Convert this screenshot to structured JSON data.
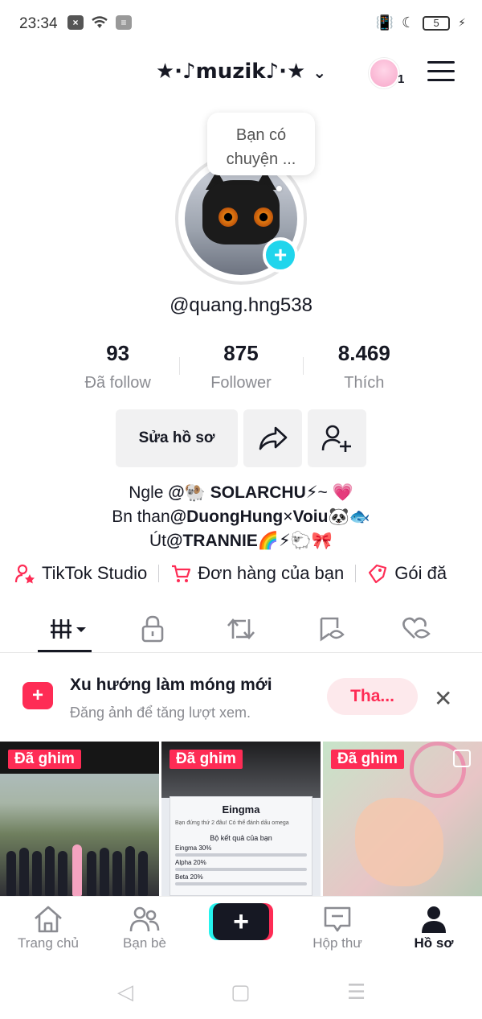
{
  "status_bar": {
    "time": "23:34",
    "battery": "5"
  },
  "header": {
    "title": "★·♪muzik♪·★",
    "notification_count": "1"
  },
  "profile": {
    "bubble_text_line1": "Bạn có",
    "bubble_text_line2": "chuyện ...",
    "username": "@quang.hng538",
    "stats": [
      {
        "value": "93",
        "label": "Đã follow"
      },
      {
        "value": "875",
        "label": "Follower"
      },
      {
        "value": "8.469",
        "label": "Thích"
      }
    ],
    "edit_label": "Sửa hồ sơ",
    "bio": {
      "line1_prefix": "Ngle ",
      "line1_bold": "@🐏 SOLARCHU",
      "line1_suffix": "⚡~ 💗",
      "line2_prefix": "Bn than",
      "line2_bold1": "@DuongHung",
      "line2_mid": "×",
      "line2_bold2": "Voiu",
      "line2_suffix": "🐼🐟",
      "line3_prefix": "Út",
      "line3_bold": "@TRANNIE",
      "line3_suffix": "🌈⚡🐑🎀"
    }
  },
  "links": [
    {
      "label": "TikTok Studio",
      "icon": "person-star-icon"
    },
    {
      "label": "Đơn hàng của bạn",
      "icon": "cart-icon"
    },
    {
      "label": "Gói đă",
      "icon": "gift-icon"
    }
  ],
  "promo": {
    "title": "Xu hướng làm móng mới",
    "subtitle": "Đăng ảnh để tăng lượt xem.",
    "button": "Tha...",
    "close": "✕"
  },
  "grid": {
    "pinned_label": "Đã ghim",
    "card_title": "Eingma",
    "card_question": "Bạn đứng thứ 2 đâu! Có thể đánh dấu omega",
    "card_heading": "Bộ kết quả của bạn",
    "card_rows": [
      "Eingma 30%",
      "Alpha 20%",
      "Beta 20%"
    ]
  },
  "bottom_nav": [
    {
      "label": "Trang chủ"
    },
    {
      "label": "Bạn bè"
    },
    {
      "label": "Hộp thư"
    },
    {
      "label": "Hồ sơ"
    }
  ],
  "colors": {
    "accent": "#fe2c55",
    "cyan": "#20d5ec"
  }
}
